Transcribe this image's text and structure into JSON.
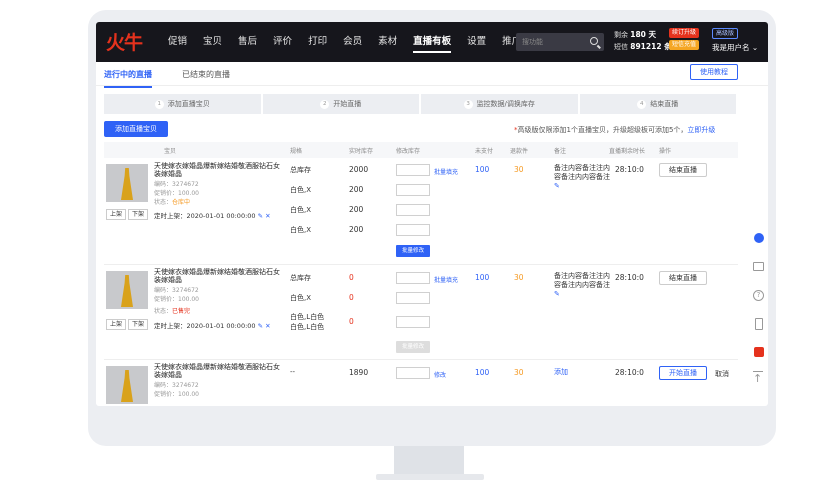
{
  "nav": {
    "logo": "火牛",
    "items": [
      "促销",
      "宝贝",
      "售后",
      "评价",
      "打印",
      "会员",
      "素材",
      "直播有板",
      "设置",
      "推广"
    ],
    "search_placeholder": "搜功能",
    "quota_line1_label": "剩余",
    "quota_line1_value": "180 天",
    "quota_line2_label": "短信",
    "quota_line2_value": "891212 条",
    "upgrade_badge": "续订升级",
    "points_badge": "短信充值",
    "version_badge": "高级版",
    "username": "我是用户名 ⌄"
  },
  "tabs": {
    "active": "进行中的直播",
    "ended": "已结束的直播",
    "tutorial": "使用教程"
  },
  "steps": [
    {
      "num": "1",
      "label": "添加直播宝贝"
    },
    {
      "num": "2",
      "label": "开始直播"
    },
    {
      "num": "3",
      "label": "监控数据/调换库存"
    },
    {
      "num": "4",
      "label": "结束直播"
    }
  ],
  "toolbar": {
    "add_button": "添加直播宝贝",
    "notice_star": "*",
    "notice_text": "高级版仅限添加1个直播宝贝，升级超级板可添加5个，",
    "notice_link": "立即升级"
  },
  "table": {
    "headers": [
      "宝贝",
      "规格",
      "实时库存",
      "修改库存",
      "未支付",
      "退款件",
      "备注",
      "直播剩余时长",
      "操作"
    ],
    "rows": [
      {
        "title": "天使嫁衣嫁婚晶爆新嫁结婚敬酒服钻石女装嫁婚晶",
        "code": "编码：3274672",
        "price": "促销价：100.00",
        "status_label": "状态：",
        "status": "仓库中",
        "up": "上架",
        "down": "下架",
        "schedule": "定时上架：2020-01-01 00:00:00",
        "specs": [
          "总库存",
          "白色,X",
          "白色,X",
          "白色,X"
        ],
        "stocks": [
          "2000",
          "200",
          "200",
          "200"
        ],
        "fill": "批量填充",
        "unpaid": "100",
        "refund": "30",
        "remark": "备注内容备注注内容备注内内容备注",
        "time": "28:10:0",
        "action": "结束直播",
        "batch": "批量修改"
      },
      {
        "title": "天使嫁衣嫁婚晶爆新嫁结婚敬酒服钻石女装嫁婚晶",
        "code": "编码：3274672",
        "price": "促销价：100.00",
        "status_label": "状态：",
        "status": "已售完",
        "up": "上架",
        "down": "下架",
        "schedule": "定时上架：2020-01-01 00:00:00",
        "specs": [
          "总库存",
          "白色,X",
          "白色,L白色",
          "白色,L白色"
        ],
        "stocks": [
          "0",
          "0",
          "0"
        ],
        "fill": "批量填充",
        "unpaid": "100",
        "refund": "30",
        "remark": "备注内容备注注内容备注内内容备注",
        "time": "28:10:0",
        "action": "结束直播",
        "batch": "批量修改"
      },
      {
        "title": "天使嫁衣嫁婚晶爆新嫁结婚敬酒服钻石女装嫁婚晶",
        "code": "编码：3274672",
        "price": "促销价：100.00",
        "spec": "--",
        "stock": "1890",
        "modify": "修改",
        "unpaid": "100",
        "refund": "30",
        "remark": "添加",
        "time": "28:10:0",
        "action": "开始直播",
        "cancel": "取消"
      }
    ]
  },
  "colors": {
    "accent": "#2f62f6",
    "danger": "#e5321d",
    "warning": "#f59a23",
    "nav_bg": "#16161c"
  }
}
